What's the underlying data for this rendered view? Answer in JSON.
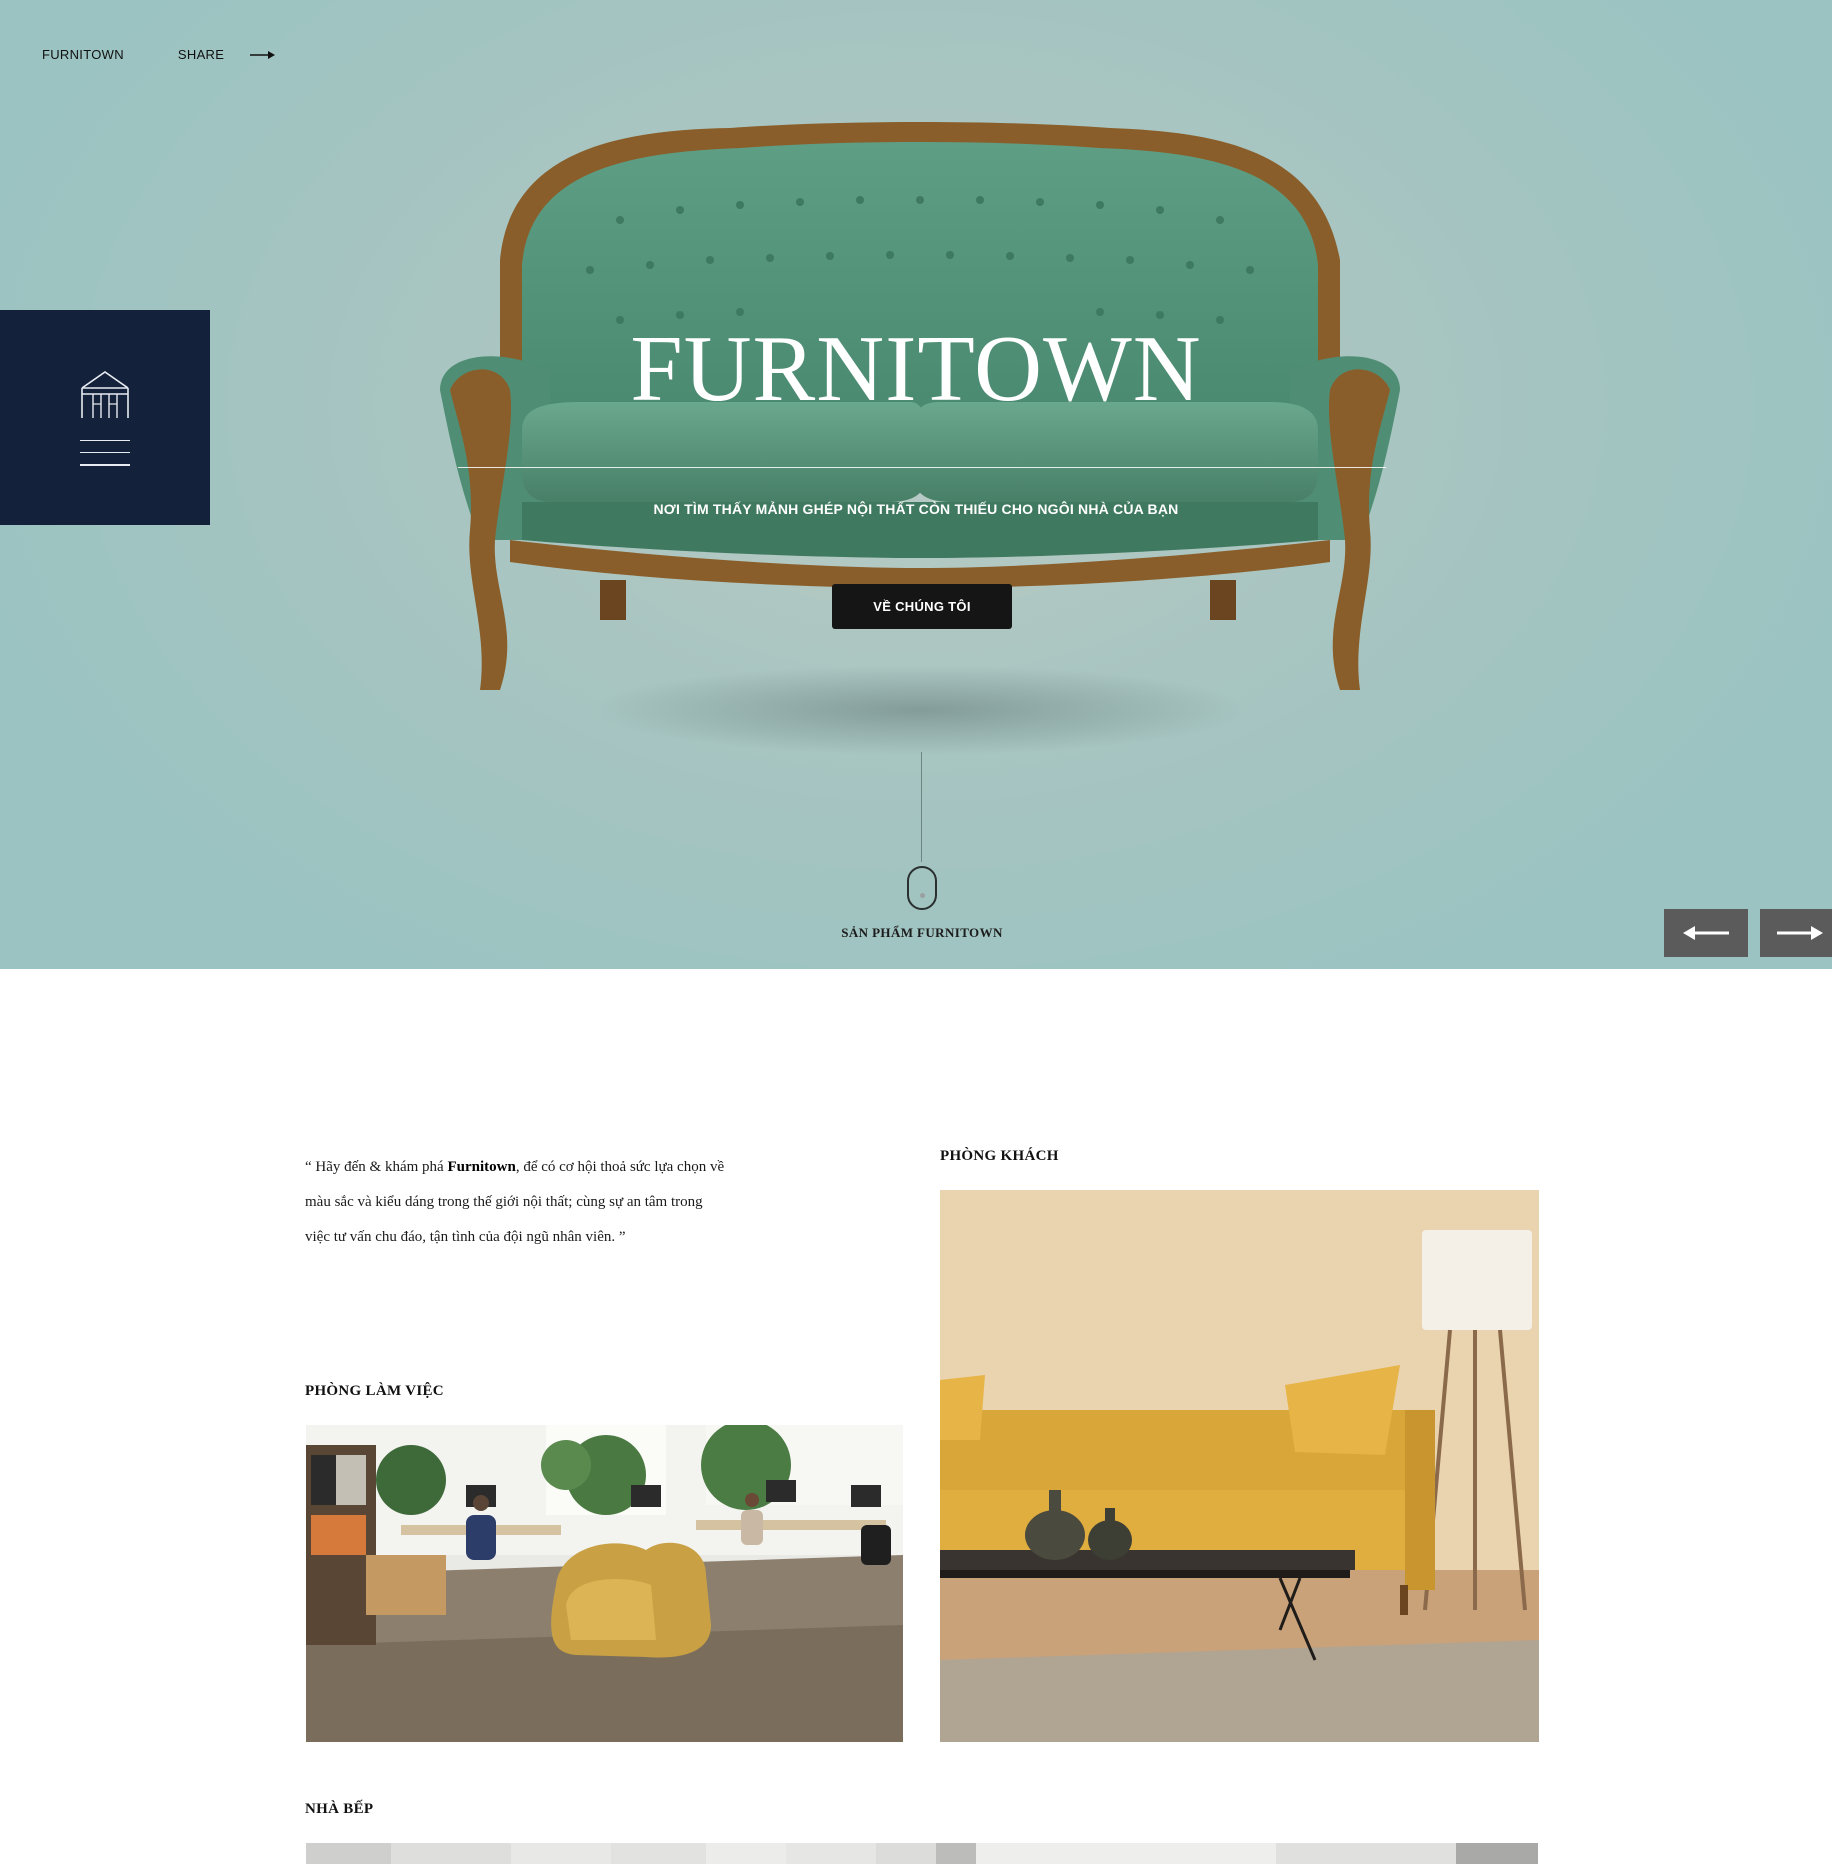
{
  "header": {
    "brand": "FURNITOWN",
    "share_label": "SHARE"
  },
  "hero": {
    "title": "FURNITOWN",
    "subtitle": "NƠI TÌM THẤY MẢNH GHÉP NỘI THẤT CÒN THIẾU CHO NGÔI NHÀ CỦA BẠN",
    "cta_label": "VỀ CHÚNG TÔI",
    "scroll_label": "SẢN PHẨM FURNITOWN",
    "icons": [
      "house-logo-icon",
      "hamburger-icon",
      "arrow-right-icon",
      "mouse-icon",
      "arrow-left-icon"
    ]
  },
  "intro": {
    "quote_open": "“ Hãy đến & khám phá ",
    "brand": "Furnitown",
    "quote_rest": ", để có cơ hội thoả sức lựa chọn về màu sắc và kiểu dáng trong thế giới nội thất; cùng sự an tâm trong việc tư vấn chu đáo, tận tình của đội ngũ nhân viên. ”"
  },
  "sections": {
    "living_room": "PHÒNG KHÁCH",
    "office": "PHÒNG LÀM VIỆC",
    "kitchen": "NHÀ BẾP"
  },
  "colors": {
    "hero_bg": "#9ac3c1",
    "menu_box": "#13213a",
    "button_dark": "#151515",
    "nav_button": "#5b5b5b"
  }
}
